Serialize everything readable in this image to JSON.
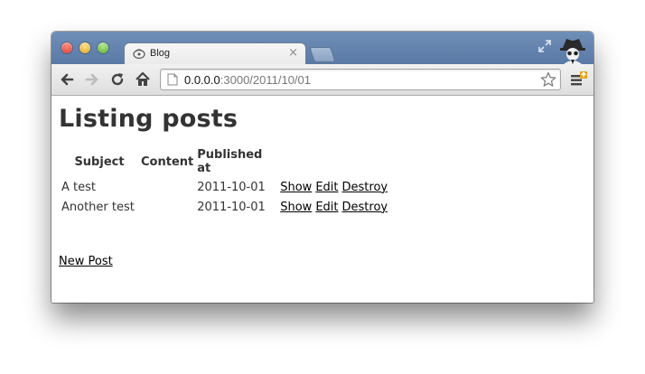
{
  "browser": {
    "tab_title": "Blog",
    "tab_close": "×",
    "url_host": "0.0.0.0",
    "url_rest": ":3000/2011/10/01"
  },
  "page": {
    "title": "Listing posts",
    "columns": [
      "Subject",
      "Content",
      "Published at"
    ],
    "rows": [
      {
        "subject": "A test",
        "content": "",
        "published_at": "2011-10-01",
        "show": "Show",
        "edit": "Edit",
        "destroy": "Destroy"
      },
      {
        "subject": "Another test",
        "content": "",
        "published_at": "2011-10-01",
        "show": "Show",
        "edit": "Edit",
        "destroy": "Destroy"
      }
    ],
    "new_post_link": "New Post"
  },
  "icons": {
    "back": "back-arrow-icon",
    "forward": "forward-arrow-icon",
    "reload": "reload-icon",
    "home": "home-icon",
    "page": "page-icon",
    "star": "bookmark-star-icon",
    "menu": "wrench-menu-icon",
    "incognito": "incognito-icon",
    "fullscreen": "fullscreen-icon"
  },
  "colors": {
    "titlebar": "#5a7aa6",
    "text": "#333333",
    "link": "#000000"
  }
}
